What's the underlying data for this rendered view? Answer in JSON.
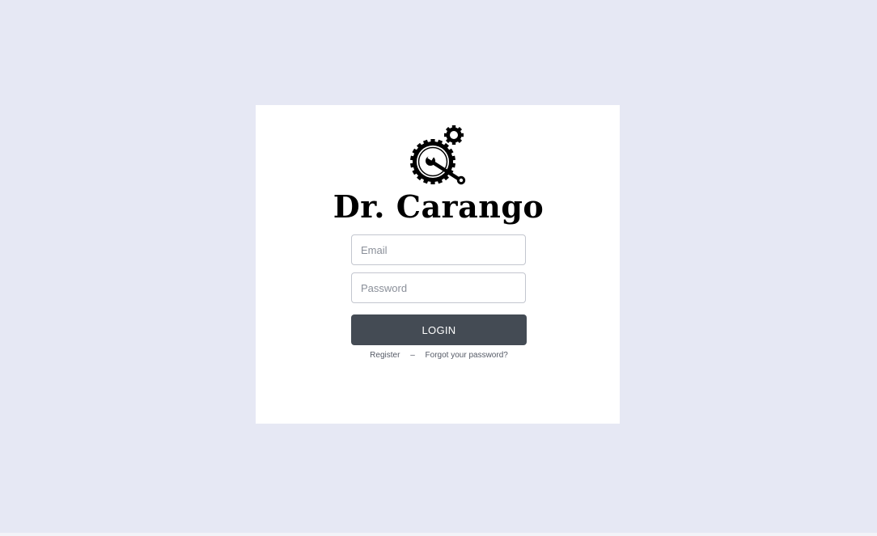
{
  "brand": {
    "name": "Dr. Carango",
    "logo_icon": "gears-wrench-icon"
  },
  "form": {
    "email_placeholder": "Email",
    "email_value": "",
    "password_placeholder": "Password",
    "password_value": "",
    "login_label": "LOGIN"
  },
  "links": {
    "register": "Register",
    "separator": "–",
    "forgot_password": "Forgot your password?"
  },
  "colors": {
    "background": "#e6e8f4",
    "card": "#ffffff",
    "button": "#444b54",
    "button_text": "#ffffff"
  }
}
